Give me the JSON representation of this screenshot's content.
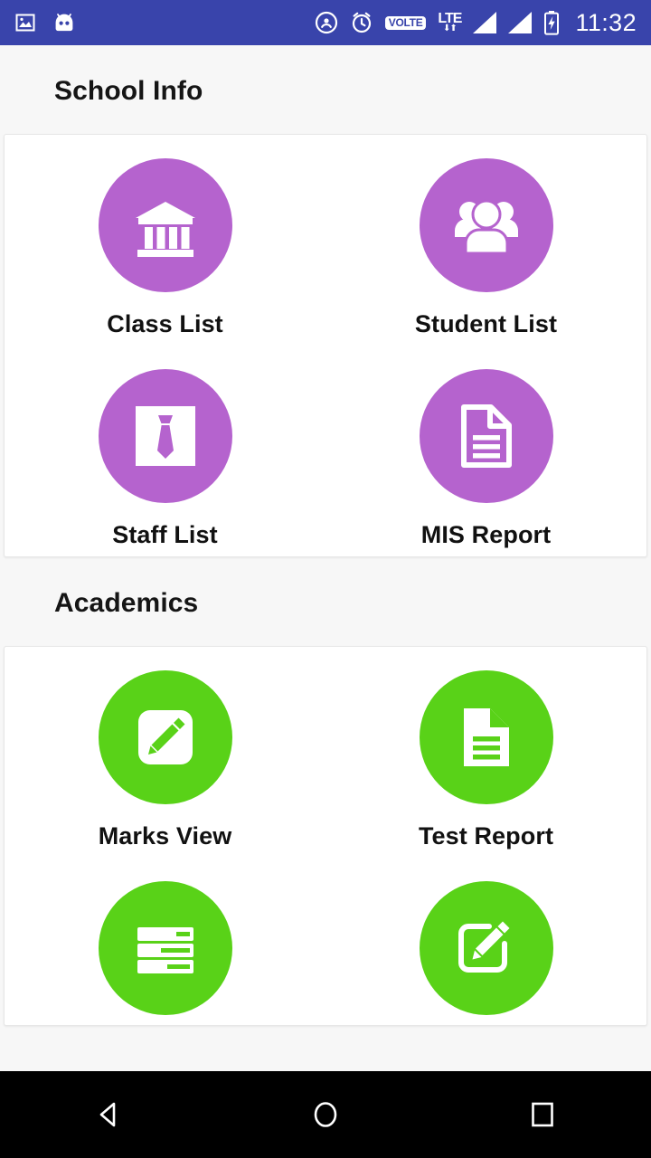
{
  "status_bar": {
    "background": "#3944ab",
    "left_icons": [
      {
        "name": "photo-icon",
        "label": "photo"
      },
      {
        "name": "android-head-icon",
        "label": "android"
      }
    ],
    "right_icons": [
      {
        "name": "cast-icon",
        "label": "cast"
      },
      {
        "name": "alarm-icon",
        "label": "alarm"
      },
      {
        "name": "volte-icon",
        "label": "VOLTE"
      },
      {
        "name": "lte-icon",
        "label": "LTE"
      },
      {
        "name": "signal-sim1-icon",
        "label": "signal"
      },
      {
        "name": "signal-sim2-icon",
        "label": "signal"
      },
      {
        "name": "battery-charging-icon",
        "label": "battery"
      }
    ],
    "volte_label": "VOLTE",
    "lte_label": "LTE",
    "lte_arrows": "⬇⬆",
    "clock": "11:32"
  },
  "sections": [
    {
      "title": "School Info",
      "accent": "#b563ce",
      "tiles": [
        {
          "label": "Class List",
          "icon": "bank-building-icon"
        },
        {
          "label": "Student List",
          "icon": "people-group-icon"
        },
        {
          "label": "Staff List",
          "icon": "necktie-icon"
        },
        {
          "label": "MIS Report",
          "icon": "document-lines-icon"
        }
      ]
    },
    {
      "title": "Academics",
      "accent": "#59d218",
      "tiles": [
        {
          "label": "Marks View",
          "icon": "pencil-square-icon"
        },
        {
          "label": "Test Report",
          "icon": "document-filled-icon"
        },
        {
          "label": "",
          "icon": "list-rows-icon"
        },
        {
          "label": "",
          "icon": "edit-note-icon"
        }
      ]
    }
  ],
  "nav_bar": {
    "buttons": [
      {
        "name": "back-button",
        "label": "Back"
      },
      {
        "name": "home-button",
        "label": "Home"
      },
      {
        "name": "recents-button",
        "label": "Recents"
      }
    ]
  }
}
